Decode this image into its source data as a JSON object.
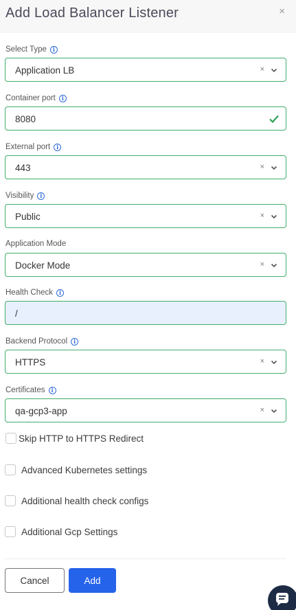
{
  "dialog": {
    "title": "Add Load Balancer Listener",
    "close_glyph": "×"
  },
  "fields": {
    "select_type": {
      "label": "Select Type",
      "value": "Application LB"
    },
    "container_port": {
      "label": "Container port",
      "value": "8080"
    },
    "external_port": {
      "label": "External port",
      "value": "443"
    },
    "visibility": {
      "label": "Visibility",
      "value": "Public"
    },
    "application_mode": {
      "label": "Application Mode",
      "value": "Docker Mode"
    },
    "health_check": {
      "label": "Health Check",
      "value": "/"
    },
    "backend_protocol": {
      "label": "Backend Protocol",
      "value": "HTTPS"
    },
    "certificates": {
      "label": "Certificates",
      "value": "qa-gcp3-app"
    }
  },
  "checkboxes": [
    {
      "label": "Skip HTTP to HTTPS Redirect",
      "checked": false
    },
    {
      "label": "Advanced Kubernetes settings",
      "checked": false
    },
    {
      "label": "Additional health check configs",
      "checked": false
    },
    {
      "label": "Additional Gcp Settings",
      "checked": false
    }
  ],
  "actions": {
    "cancel": "Cancel",
    "add": "Add"
  },
  "glyphs": {
    "clear": "×",
    "info": "i"
  },
  "colors": {
    "accent": "#2563eb",
    "field_border": "#3fae6b",
    "success": "#2ea05a",
    "chat_bg": "#1d2b45",
    "readonly_bg": "#e8f0fe"
  }
}
